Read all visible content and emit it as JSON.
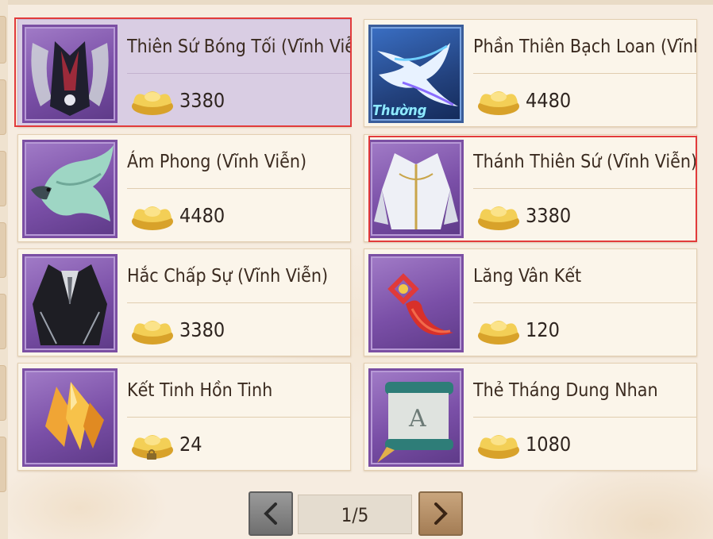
{
  "shop": {
    "items": [
      {
        "name": "Thiên Sứ Bóng Tối (Vĩnh Viễn)",
        "price": "3380",
        "thumb_icon": "dark-angel-outfit-icon",
        "selected": true
      },
      {
        "name": "Phần Thiên Bạch Loan (Vĩnh viễ",
        "price": "4480",
        "thumb_icon": "white-phoenix-mount-icon",
        "tag": "Thường"
      },
      {
        "name": "Ám Phong (Vĩnh Viễn)",
        "price": "4480",
        "thumb_icon": "eagle-mount-icon"
      },
      {
        "name": "Thánh Thiên Sứ (Vĩnh Viễn)",
        "price": "3380",
        "thumb_icon": "holy-angel-outfit-icon"
      },
      {
        "name": "Hắc Chấp Sự (Vĩnh Viễn)",
        "price": "3380",
        "thumb_icon": "black-butler-outfit-icon"
      },
      {
        "name": "Lăng Vân Kết",
        "price": "120",
        "thumb_icon": "red-knot-charm-icon"
      },
      {
        "name": "Kết Tinh Hồn Tinh",
        "price": "24",
        "thumb_icon": "soul-crystal-icon",
        "locked_currency": true
      },
      {
        "name": "Thẻ Tháng Dung Nhan",
        "price": "1080",
        "thumb_icon": "scroll-card-icon"
      }
    ]
  },
  "pager": {
    "page_label": "1/5",
    "prev_icon": "chevron-left-icon",
    "next_icon": "chevron-right-icon"
  },
  "colors": {
    "highlight_border": "#e23b3b",
    "card_selected_bg": "#d9cde3",
    "card_bg": "#fbf5ea",
    "thumb_purple": "#7a4fa7",
    "gold": "#e8b93c"
  }
}
